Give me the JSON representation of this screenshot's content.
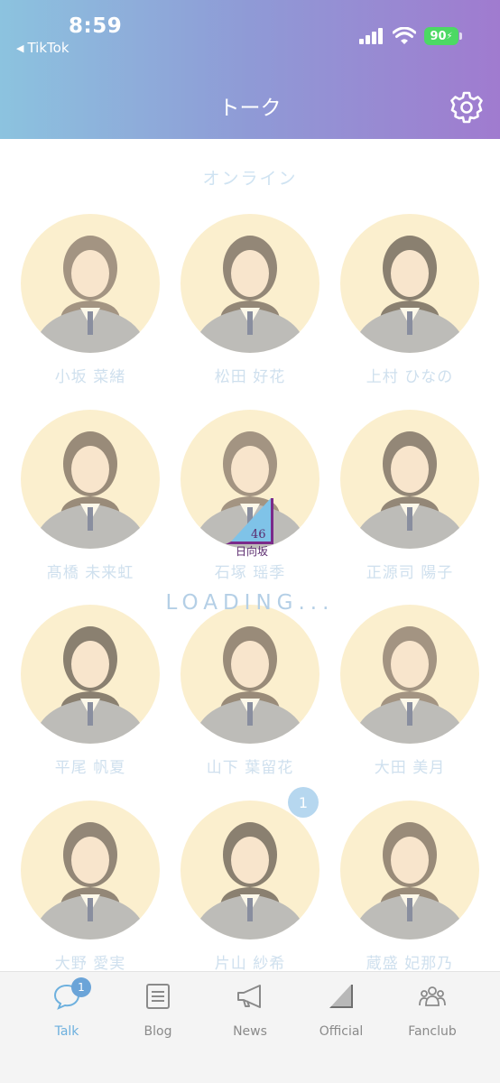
{
  "status_bar": {
    "time": "8:59",
    "back_app": "TikTok",
    "battery": "90"
  },
  "header": {
    "title": "トーク"
  },
  "section": {
    "title": "オンライン"
  },
  "members": [
    {
      "name": "小坂 菜緒"
    },
    {
      "name": "松田 好花"
    },
    {
      "name": "上村 ひなの"
    },
    {
      "name": "髙橋 未来虹"
    },
    {
      "name": "石塚 瑶季"
    },
    {
      "name": "正源司 陽子"
    },
    {
      "name": "平尾 帆夏"
    },
    {
      "name": "山下 葉留花"
    },
    {
      "name": "大田 美月"
    },
    {
      "name": "大野 愛実"
    },
    {
      "name": "片山 紗希",
      "badge": "1"
    },
    {
      "name": "蔵盛 妃那乃"
    }
  ],
  "overlay": {
    "loading": "LOADING...",
    "logo_text": "日向坂",
    "logo_number": "46"
  },
  "tabbar": {
    "tabs": [
      {
        "label": "Talk",
        "icon": "chat-bubble-icon",
        "badge": "1",
        "active": true
      },
      {
        "label": "Blog",
        "icon": "document-icon"
      },
      {
        "label": "News",
        "icon": "megaphone-icon"
      },
      {
        "label": "Official",
        "icon": "triangle-logo-icon"
      },
      {
        "label": "Fanclub",
        "icon": "group-icon"
      }
    ]
  },
  "colors": {
    "header_start": "#8cc3df",
    "header_end": "#a07bcf",
    "active_tab": "#6db0de",
    "avatar_bg": "#fbefce"
  }
}
